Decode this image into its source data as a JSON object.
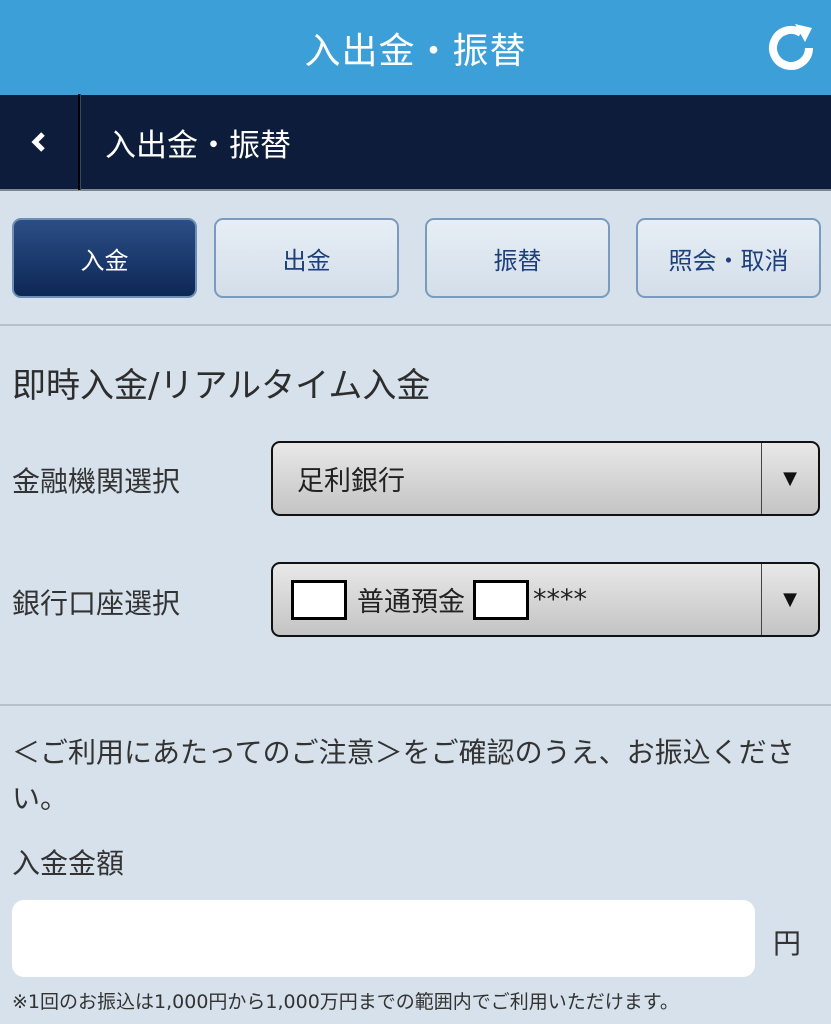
{
  "header": {
    "title": "入出金・振替",
    "refresh_icon": "refresh-icon"
  },
  "navbar": {
    "back_icon": "chevron-left-icon",
    "title": "入出金・振替"
  },
  "tabs": [
    {
      "label": "入金",
      "active": true
    },
    {
      "label": "出金",
      "active": false
    },
    {
      "label": "振替",
      "active": false
    },
    {
      "label": "照会・取消",
      "active": false
    }
  ],
  "section": {
    "title": "即時入金/リアルタイム入金"
  },
  "bank_select": {
    "label": "金融機関選択",
    "value": "足利銀行"
  },
  "account_select": {
    "label": "銀行口座選択",
    "value": "普通預金",
    "masked_suffix": "****"
  },
  "notice": {
    "text": "＜ご利用にあたってのご注意＞をご確認のうえ、お振込ください。"
  },
  "amount": {
    "label": "入金金額",
    "value": "",
    "placeholder": "",
    "unit": "円"
  },
  "footnote": "※1回のお振込は1,000円から1,000万円までの範囲内でご利用いただけます。",
  "colors": {
    "header_bg": "#3d9fd8",
    "navbar_bg": "#0c1c3a",
    "page_bg": "#d6e1eb",
    "tab_active_bg": "#0d2756",
    "tab_text": "#1d3f7a"
  }
}
